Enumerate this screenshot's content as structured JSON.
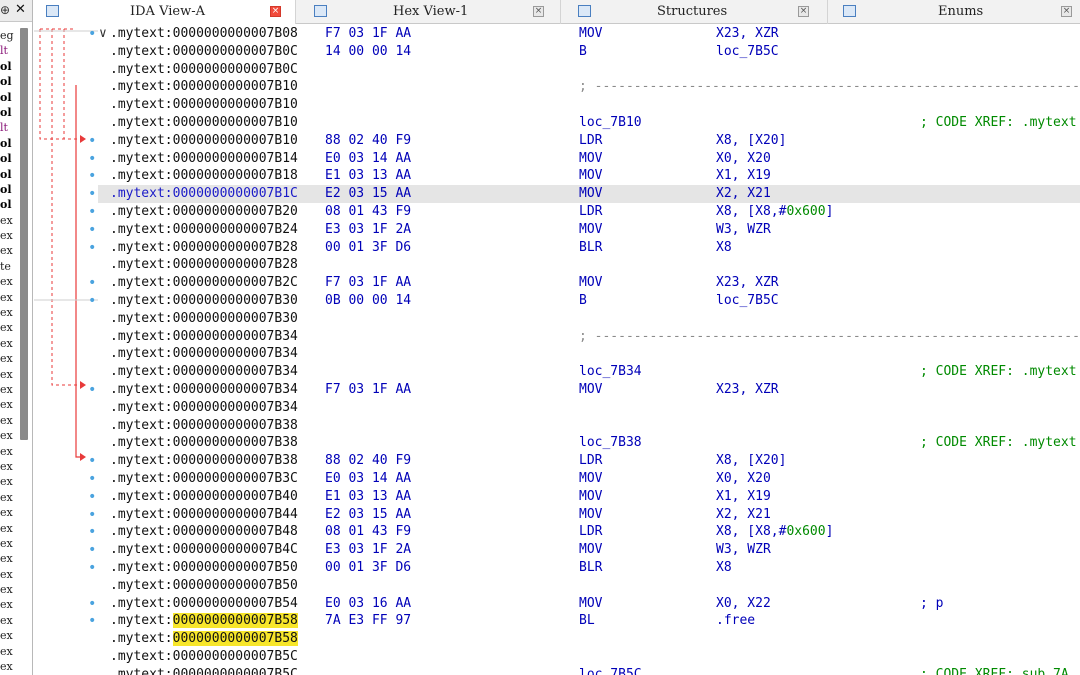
{
  "left_pane": {
    "header_pin": "⊕",
    "header_close": "✕",
    "truncated_items": [
      "eg",
      "lt",
      "ol",
      "ol",
      "ol",
      "ol",
      "lt",
      "ol",
      "ol",
      "ol",
      "ol",
      "ol",
      "ex",
      "ex",
      "ex",
      "te",
      "ex",
      "ex",
      "ex",
      "ex",
      "ex",
      "ex",
      "ex",
      "ex",
      "ex",
      "ex",
      "ex",
      "ex",
      "ex",
      "ex",
      "ex",
      "ex",
      "ex",
      "ex",
      "ex",
      "ex",
      "ex",
      "ex",
      "ex",
      "ex",
      "ex",
      "ex",
      "ex"
    ]
  },
  "tabs": [
    {
      "label": "IDA View-A",
      "icon": "list-view-icon",
      "active": true
    },
    {
      "label": "Hex View-1",
      "icon": "hex-view-icon",
      "active": false
    },
    {
      "label": "Structures",
      "icon": "structures-icon",
      "active": false
    },
    {
      "label": "Enums",
      "icon": "enums-icon",
      "active": false
    }
  ],
  "colors": {
    "highlight_row": "#e5e5e5",
    "address_highlight": "#f7e62a",
    "code_blue": "#0000b8",
    "comment_green": "#008a00",
    "active_tab_close": "#f24b3c"
  },
  "segment": ".mytext",
  "rows": [
    {
      "addr": "0000000000007B08",
      "bytes": "F7 03 1F AA",
      "mn": "MOV",
      "op": "X23, XZR",
      "dot": true,
      "fold": true
    },
    {
      "addr": "0000000000007B0C",
      "bytes": "14 00 00 14",
      "mn": "B",
      "op": "loc_7B5C"
    },
    {
      "addr": "0000000000007B0C"
    },
    {
      "addr": "0000000000007B10",
      "sep": "; ---------------------------------------------------------------------------"
    },
    {
      "addr": "0000000000007B10"
    },
    {
      "addr": "0000000000007B10",
      "label": "loc_7B10",
      "comment": "; CODE XREF: .mytext"
    },
    {
      "addr": "0000000000007B10",
      "bytes": "88 02 40 F9",
      "mn": "LDR",
      "op": "X8, [X20]",
      "dot": true
    },
    {
      "addr": "0000000000007B14",
      "bytes": "E0 03 14 AA",
      "mn": "MOV",
      "op": "X0, X20",
      "dot": true
    },
    {
      "addr": "0000000000007B18",
      "bytes": "E1 03 13 AA",
      "mn": "MOV",
      "op": "X1, X19",
      "dot": true
    },
    {
      "addr": "0000000000007B1C",
      "bytes": "E2 03 15 AA",
      "mn": "MOV",
      "op": "X2, X21",
      "dot": true,
      "highlight": true
    },
    {
      "addr": "0000000000007B20",
      "bytes": "08 01 43 F9",
      "mn": "LDR",
      "op": "X8, [X8,#",
      "opnum": "0x600",
      "optail": "]",
      "dot": true
    },
    {
      "addr": "0000000000007B24",
      "bytes": "E3 03 1F 2A",
      "mn": "MOV",
      "op": "W3, WZR",
      "dot": true
    },
    {
      "addr": "0000000000007B28",
      "bytes": "00 01 3F D6",
      "mn": "BLR",
      "op": "X8",
      "dot": true
    },
    {
      "addr": "0000000000007B28"
    },
    {
      "addr": "0000000000007B2C",
      "bytes": "F7 03 1F AA",
      "mn": "MOV",
      "op": "X23, XZR",
      "dot": true
    },
    {
      "addr": "0000000000007B30",
      "bytes": "0B 00 00 14",
      "mn": "B",
      "op": "loc_7B5C",
      "dot": true
    },
    {
      "addr": "0000000000007B30"
    },
    {
      "addr": "0000000000007B34",
      "sep": "; ---------------------------------------------------------------------------"
    },
    {
      "addr": "0000000000007B34"
    },
    {
      "addr": "0000000000007B34",
      "label": "loc_7B34",
      "comment": "; CODE XREF: .mytext"
    },
    {
      "addr": "0000000000007B34",
      "bytes": "F7 03 1F AA",
      "mn": "MOV",
      "op": "X23, XZR",
      "dot": true
    },
    {
      "addr": "0000000000007B34"
    },
    {
      "addr": "0000000000007B38"
    },
    {
      "addr": "0000000000007B38",
      "label": "loc_7B38",
      "comment": "; CODE XREF: .mytext"
    },
    {
      "addr": "0000000000007B38",
      "bytes": "88 02 40 F9",
      "mn": "LDR",
      "op": "X8, [X20]",
      "dot": true
    },
    {
      "addr": "0000000000007B3C",
      "bytes": "E0 03 14 AA",
      "mn": "MOV",
      "op": "X0, X20",
      "dot": true
    },
    {
      "addr": "0000000000007B40",
      "bytes": "E1 03 13 AA",
      "mn": "MOV",
      "op": "X1, X19",
      "dot": true
    },
    {
      "addr": "0000000000007B44",
      "bytes": "E2 03 15 AA",
      "mn": "MOV",
      "op": "X2, X21",
      "dot": true
    },
    {
      "addr": "0000000000007B48",
      "bytes": "08 01 43 F9",
      "mn": "LDR",
      "op": "X8, [X8,#",
      "opnum": "0x600",
      "optail": "]",
      "dot": true
    },
    {
      "addr": "0000000000007B4C",
      "bytes": "E3 03 1F 2A",
      "mn": "MOV",
      "op": "W3, WZR",
      "dot": true
    },
    {
      "addr": "0000000000007B50",
      "bytes": "00 01 3F D6",
      "mn": "BLR",
      "op": "X8",
      "dot": true
    },
    {
      "addr": "0000000000007B50"
    },
    {
      "addr": "0000000000007B54",
      "bytes": "E0 03 16 AA",
      "mn": "MOV",
      "op": "X0, X22",
      "comment": "; p",
      "commentBlue": true,
      "dot": true
    },
    {
      "addr": "0000000000007B58",
      "bytes": "7A E3 FF 97",
      "mn": "BL",
      "op": ".free",
      "yellow": true,
      "dot": true
    },
    {
      "addr": "0000000000007B58",
      "yellow": true
    },
    {
      "addr": "0000000000007B5C"
    },
    {
      "addr": "0000000000007B5C",
      "label": "loc_7B5C",
      "comment": "; CODE XREF: sub_7A"
    }
  ]
}
